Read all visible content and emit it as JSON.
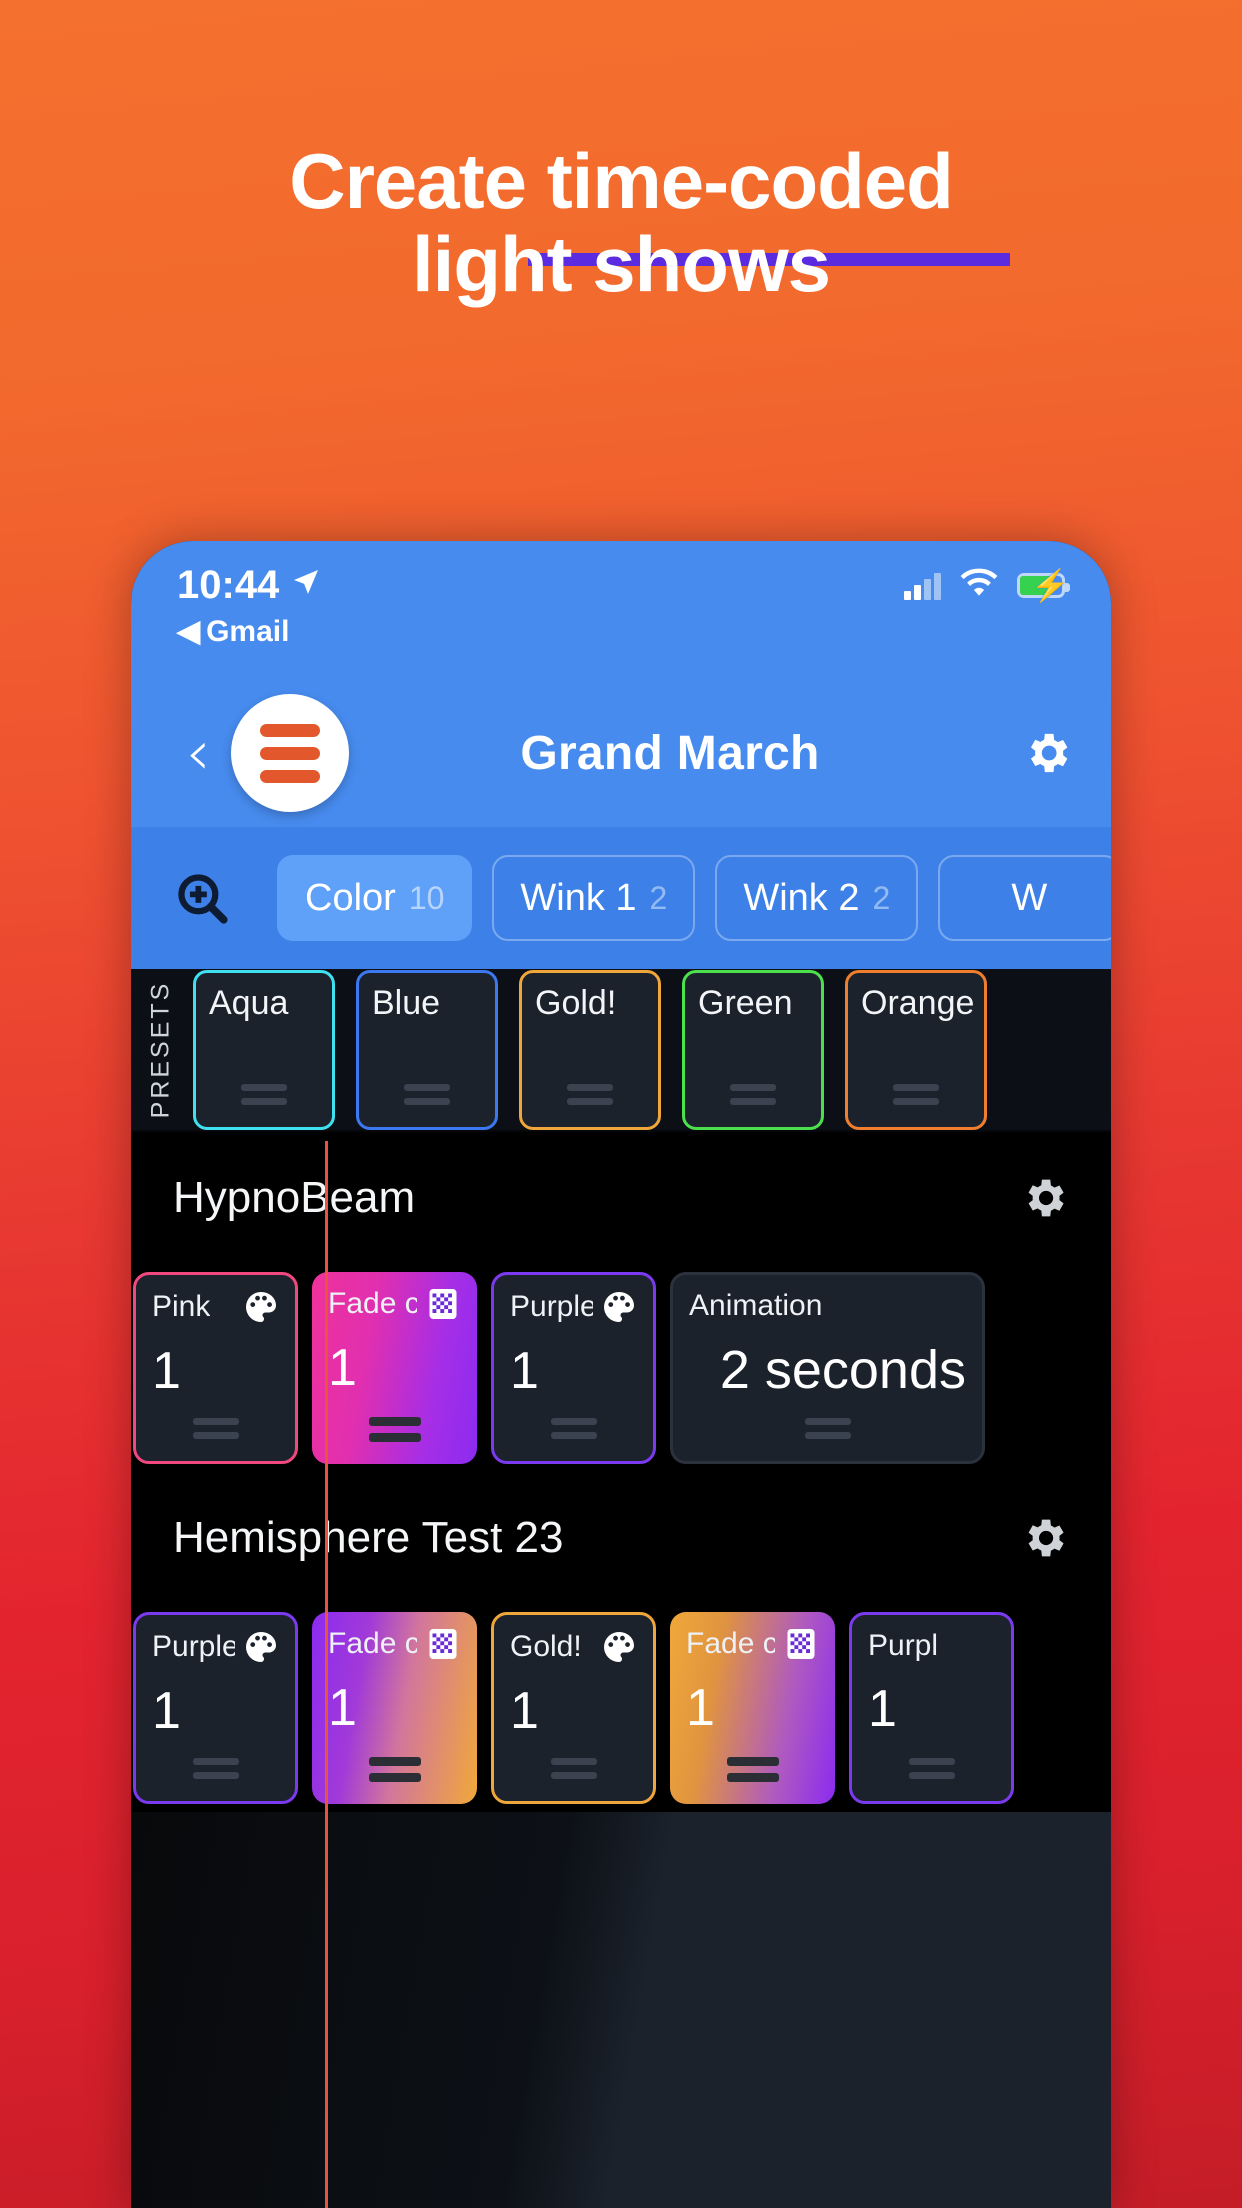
{
  "promo": {
    "headline_line1": "Create time-coded",
    "headline_line2": "light shows",
    "underline_color": "#5B2BE0",
    "background_top_color": "#F4702E",
    "background_bottom_color": "#C41D28"
  },
  "status_bar": {
    "time": "10:44",
    "location_icon": "location-arrow-icon",
    "back_app_label": "Gmail",
    "signal_icon": "cellular-signal-icon",
    "signal_bars_filled": 2,
    "signal_bars_total": 4,
    "wifi_icon": "wifi-icon",
    "battery_icon": "battery-charging-icon",
    "battery_color": "#35D14F"
  },
  "nav_bar": {
    "back_icon": "chevron-left-icon",
    "logo_icon": "hamburger-logo-icon",
    "title": "Grand March",
    "settings_icon": "gear-icon",
    "background_color": "#478BEE"
  },
  "tab_bar": {
    "zoom_icon": "zoom-in-icon",
    "tabs": [
      {
        "label": "Color",
        "count": "10",
        "active": true
      },
      {
        "label": "Wink 1",
        "count": "2",
        "active": false
      },
      {
        "label": "Wink 2",
        "count": "2",
        "active": false
      },
      {
        "label": "W",
        "count": "",
        "active": false
      }
    ]
  },
  "presets": {
    "label": "PRESETS",
    "items": [
      {
        "name": "Aqua",
        "border_color": "#3FE0F0"
      },
      {
        "name": "Blue",
        "border_color": "#3C78F0"
      },
      {
        "name": "Gold!",
        "border_color": "#EFA63A"
      },
      {
        "name": "Green",
        "border_color": "#4CE04C"
      },
      {
        "name": "Orange",
        "border_color": "#EF7F2E"
      }
    ]
  },
  "tracks": [
    {
      "name": "HypnoBeam",
      "settings_icon": "gear-icon",
      "clips": [
        {
          "label": "Pink",
          "icon": "palette-icon",
          "value": "1",
          "border_color": "#F0487F",
          "fill": "solid",
          "wide": false
        },
        {
          "label": "Fade c",
          "icon": "checkered-icon",
          "value": "1",
          "gradient_from": "#F0329B",
          "gradient_to": "#8C2BF0",
          "fill": "gradient",
          "wide": false
        },
        {
          "label": "Purple",
          "icon": "palette-icon",
          "value": "1",
          "border_color": "#7C3AF0",
          "fill": "solid",
          "wide": false
        },
        {
          "label": "Animation",
          "icon": "",
          "value": "2 seconds",
          "border_color": "#2b323c",
          "fill": "solid",
          "wide": true
        }
      ]
    },
    {
      "name": "Hemisphere Test 23",
      "settings_icon": "gear-icon",
      "clips": [
        {
          "label": "Purple",
          "icon": "palette-icon",
          "value": "1",
          "border_color": "#7C3AF0",
          "fill": "solid",
          "wide": false
        },
        {
          "label": "Fade c",
          "icon": "checkered-icon",
          "value": "1",
          "gradient_from": "#8C2BF0",
          "gradient_to": "#F0A83A",
          "fill": "gradient",
          "wide": false
        },
        {
          "label": "Gold!",
          "icon": "palette-icon",
          "value": "1",
          "border_color": "#EFA63A",
          "fill": "solid",
          "wide": false
        },
        {
          "label": "Fade c",
          "icon": "checkered-icon",
          "value": "1",
          "gradient_from": "#F0A83A",
          "gradient_to": "#8C2BF0",
          "fill": "gradient",
          "wide": false
        },
        {
          "label": "Purpl",
          "icon": "",
          "value": "1",
          "border_color": "#7C3AF0",
          "fill": "solid",
          "wide": false
        }
      ]
    }
  ],
  "playhead": {
    "color": "#E8543E"
  }
}
